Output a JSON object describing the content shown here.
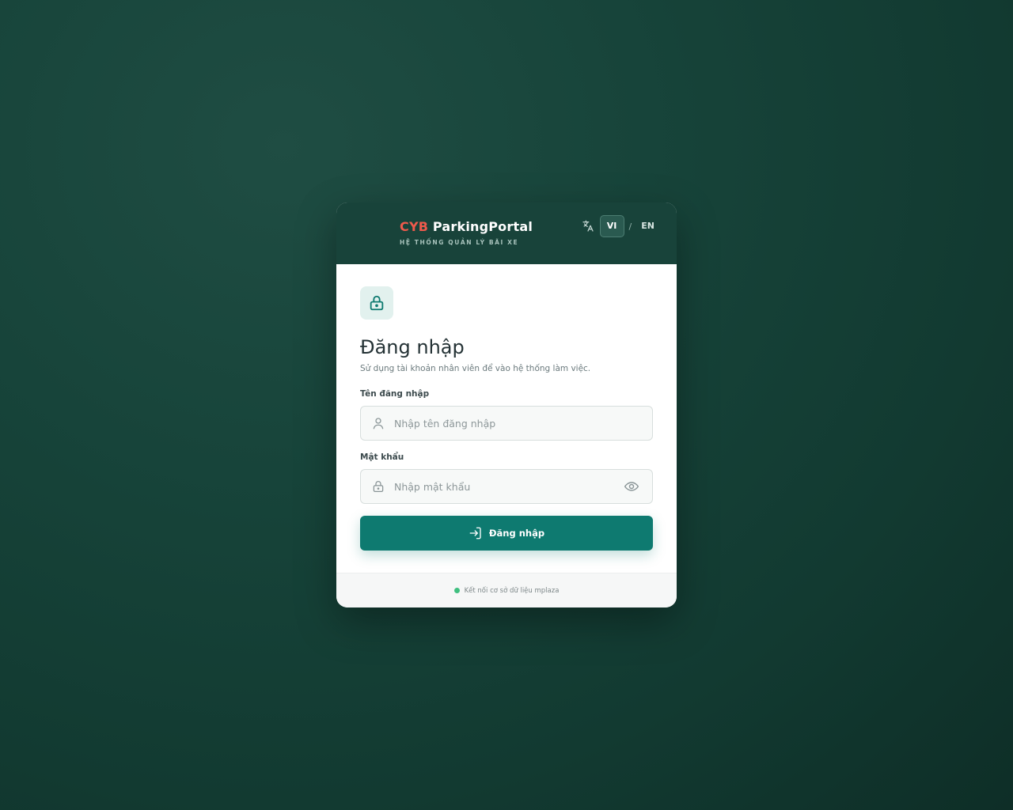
{
  "header": {
    "brand_accent": "CYB",
    "brand_name": "ParkingPortal",
    "brand_subtitle": "HỆ THỐNG QUẢN LÝ BÃI XE",
    "language": {
      "icon": "translate-icon",
      "options": [
        "VI",
        "EN"
      ],
      "selected": "VI",
      "separator": "/"
    }
  },
  "login": {
    "icon": "lock-icon",
    "title": "Đăng nhập",
    "subtitle": "Sử dụng tài khoản nhân viên để vào hệ thống làm việc.",
    "username": {
      "label": "Tên đăng nhập",
      "placeholder": "Nhập tên đăng nhập",
      "value": "",
      "icon": "user-icon"
    },
    "password": {
      "label": "Mật khẩu",
      "placeholder": "Nhập mật khẩu",
      "value": "",
      "icon": "lock-icon",
      "toggle_icon": "eye-icon"
    },
    "submit_label": "Đăng nhập",
    "submit_icon": "login-icon"
  },
  "footer": {
    "status_text": "Kết nối cơ sở dữ liệu mplaza",
    "status_color": "#3fbf7f"
  },
  "colors": {
    "background": "#16403a",
    "header": "#18433a",
    "accent": "#ef5a4c",
    "primary": "#0e7a70"
  }
}
